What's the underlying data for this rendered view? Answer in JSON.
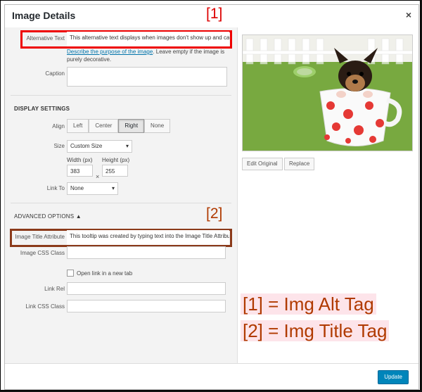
{
  "modal": {
    "title": "Image Details",
    "close_symbol": "×"
  },
  "annotations": {
    "a1": "[1]",
    "a2": "[2]",
    "legend1": "[1] = Img Alt Tag",
    "legend2": "[2] = Img Title Tag"
  },
  "fields": {
    "alt_label": "Alternative Text",
    "alt_value": "This alternative text displays when images don't show up and can b",
    "alt_help_link": "Describe the purpose of the image",
    "alt_help_rest": ". Leave empty if the image is",
    "alt_help_line2": "purely decorative.",
    "caption_label": "Caption",
    "caption_value": ""
  },
  "display": {
    "section": "DISPLAY SETTINGS",
    "align_label": "Align",
    "align_options": [
      "Left",
      "Center",
      "Right",
      "None"
    ],
    "align_selected": "Right",
    "size_label": "Size",
    "size_value": "Custom Size",
    "width_label": "Width (px)",
    "height_label": "Height (px)",
    "width_value": "383",
    "height_value": "255",
    "times": "×",
    "link_to_label": "Link To",
    "link_to_value": "None"
  },
  "advanced": {
    "section": "ADVANCED OPTIONS",
    "toggle": "▲",
    "title_attr_label": "Image Title Attribute",
    "title_attr_value": "This tooltip was created by typing text into the Image Title Attribut",
    "css_class_label": "Image CSS Class",
    "css_class_value": "",
    "new_tab_label": "Open link in a new tab",
    "link_rel_label": "Link Rel",
    "link_rel_value": "",
    "link_css_label": "Link CSS Class",
    "link_css_value": ""
  },
  "preview": {
    "edit_original": "Edit Original",
    "replace": "Replace"
  },
  "footer": {
    "update": "Update"
  },
  "colors": {
    "accent": "#0085ba",
    "annotation_red": "#dd0000",
    "annotation_brown": "#b03a00"
  }
}
